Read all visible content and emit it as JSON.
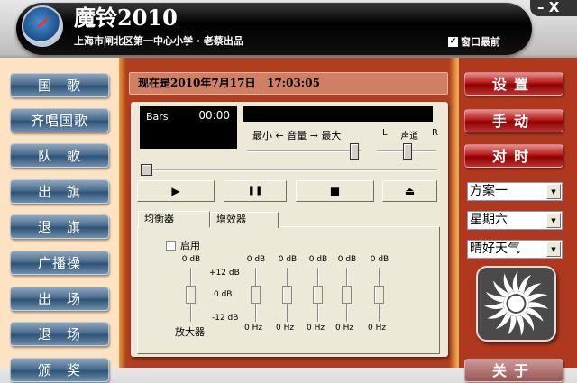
{
  "app": {
    "title": "魔铃2010",
    "subtitle": "上海市闸北区第一中心小学 · 老蔡出品",
    "always_on_top_label": "窗口最前",
    "always_on_top_checked": true,
    "window_controls": "– X"
  },
  "left_buttons": [
    "国　歌",
    "齐唱国歌",
    "队　歌",
    "出　旗",
    "退　旗",
    "广播操",
    "出　场",
    "退　场",
    "颁　奖"
  ],
  "status": {
    "datetime": "现在是2010年7月17日   17:03:05"
  },
  "player": {
    "display_label": "Bars",
    "time": "00:00",
    "volume_label": "最小 ← 音量 → 最大",
    "balance_left": "L",
    "balance_label": "声道",
    "balance_right": "R",
    "volume_level": 0.9,
    "balance_level": 0.5,
    "seek_position": 0,
    "controls": [
      "▶",
      "❚❚",
      "■",
      "⏏"
    ]
  },
  "tabs": [
    "均衡器",
    "增效器"
  ],
  "equalizer": {
    "enable_label": "启用",
    "enabled": false,
    "preamp_value": "0 dB",
    "preamp_label": "放大器",
    "scale_top": "+12 dB",
    "scale_mid": "0 dB",
    "scale_bottom": "-12 dB",
    "bands": [
      {
        "gain": "0 dB",
        "freq": "0 Hz"
      },
      {
        "gain": "0 dB",
        "freq": "0 Hz"
      },
      {
        "gain": "0 dB",
        "freq": "0 Hz"
      },
      {
        "gain": "0 dB",
        "freq": "0 Hz"
      },
      {
        "gain": "0 dB",
        "freq": "0 Hz"
      }
    ]
  },
  "right_buttons": [
    "设置",
    "手动",
    "对时",
    "关于"
  ],
  "selects": {
    "plan": "方案一",
    "weekday": "星期六",
    "weather": "晴好天气"
  },
  "colors": {
    "left_button": "#4a6d8f",
    "right_button": "#b81818",
    "frame": "#b03e20"
  }
}
